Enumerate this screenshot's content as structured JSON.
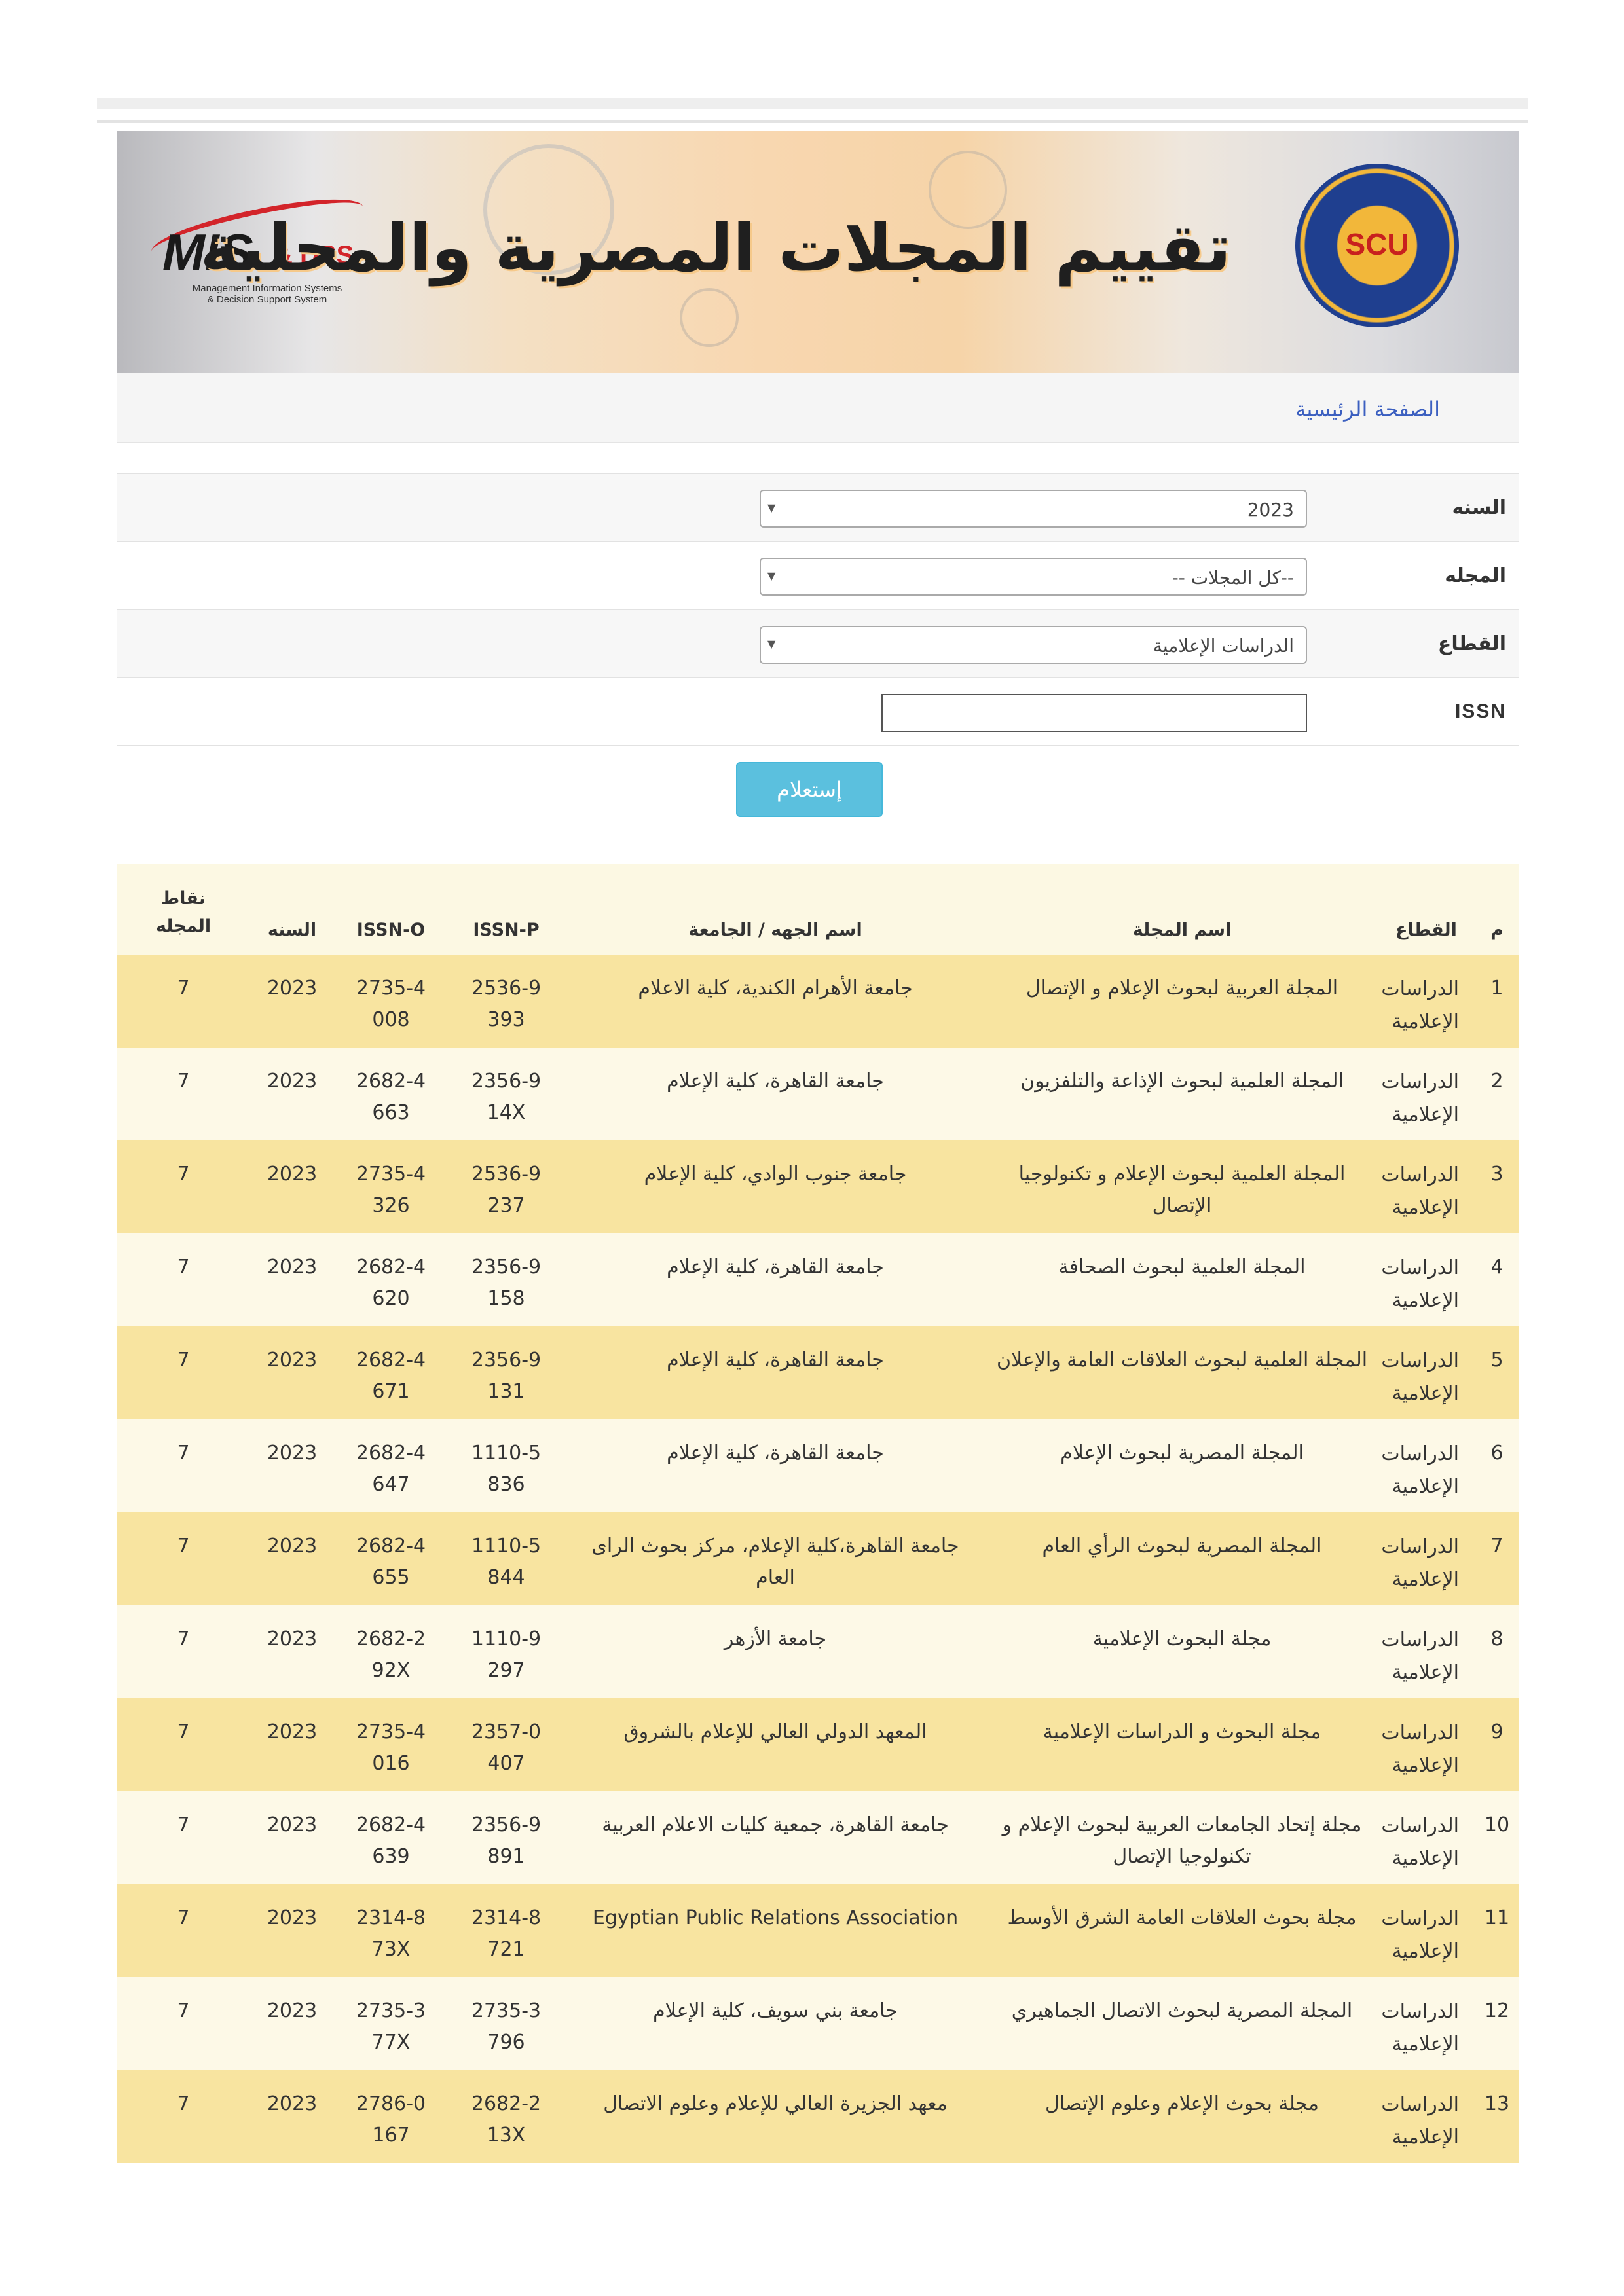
{
  "header": {
    "title": "تقييم المجلات المصرية والمحلية",
    "left_logo": {
      "main": "MIS",
      "accent": "& DSS",
      "sub1": "Management Information Systems",
      "sub2": "& Decision Support System"
    },
    "right_logo": {
      "text": "SCU"
    }
  },
  "breadcrumb": {
    "home": "الصفحة الرئيسية"
  },
  "form": {
    "year_label": "السنه",
    "year_value": "2023",
    "journal_label": "المجله",
    "journal_value": "--كل المجلات --",
    "sector_label": "القطاع",
    "sector_value": "الدراسات الإعلامية",
    "issn_label": "ISSN",
    "issn_value": "",
    "submit_label": "إستعلام"
  },
  "table": {
    "headers": {
      "num": "م",
      "sector": "القطاع",
      "journal": "اسم المجلة",
      "institution": "اسم الجهه / الجامعة",
      "issn_p": "ISSN-P",
      "issn_o": "ISSN-O",
      "year": "السنه",
      "points": "نقاط المجله"
    },
    "rows": [
      {
        "num": "1",
        "sector": "الدراسات الإعلامية",
        "journal": "المجلة العربية لبحوث الإعلام و الإتصال",
        "institution": "جامعة الأهرام الكندية، كلية الاعلام",
        "issn_p": "2536-9393",
        "issn_o": "2735-4008",
        "year": "2023",
        "points": "7"
      },
      {
        "num": "2",
        "sector": "الدراسات الإعلامية",
        "journal": "المجلة العلمية لبحوث الإذاعة والتلفزيون",
        "institution": "جامعة القاهرة، كلية الإعلام",
        "issn_p": "2356-914X",
        "issn_o": "2682-4663",
        "year": "2023",
        "points": "7"
      },
      {
        "num": "3",
        "sector": "الدراسات الإعلامية",
        "journal": "المجلة العلمية لبحوث الإعلام و تكنولوجيا الإتصال",
        "institution": "جامعة جنوب الوادي، كلية الإعلام",
        "issn_p": "2536-9237",
        "issn_o": "2735-4326",
        "year": "2023",
        "points": "7"
      },
      {
        "num": "4",
        "sector": "الدراسات الإعلامية",
        "journal": "المجلة العلمية لبحوث الصحافة",
        "institution": "جامعة القاهرة، كلية الإعلام",
        "issn_p": "2356-9158",
        "issn_o": "2682-4620",
        "year": "2023",
        "points": "7"
      },
      {
        "num": "5",
        "sector": "الدراسات الإعلامية",
        "journal": "المجلة العلمية لبحوث العلاقات العامة والإعلان",
        "institution": "جامعة القاهرة، كلية الإعلام",
        "issn_p": "2356-9131",
        "issn_o": "2682-4671",
        "year": "2023",
        "points": "7"
      },
      {
        "num": "6",
        "sector": "الدراسات الإعلامية",
        "journal": "المجلة المصرية لبحوث الإعلام",
        "institution": "جامعة القاهرة، كلية الإعلام",
        "issn_p": "1110-5836",
        "issn_o": "2682-4647",
        "year": "2023",
        "points": "7"
      },
      {
        "num": "7",
        "sector": "الدراسات الإعلامية",
        "journal": "المجلة المصرية لبحوث الرأي العام",
        "institution": "جامعة القاهرة،كلية الإعلام، مركز بحوث الراى العام",
        "issn_p": "1110-5844",
        "issn_o": "2682-4655",
        "year": "2023",
        "points": "7"
      },
      {
        "num": "8",
        "sector": "الدراسات الإعلامية",
        "journal": "مجلة البحوث الإعلامية",
        "institution": "جامعة الأزهر",
        "issn_p": "1110-9297",
        "issn_o": "2682-292X",
        "year": "2023",
        "points": "7"
      },
      {
        "num": "9",
        "sector": "الدراسات الإعلامية",
        "journal": "مجلة البحوث و الدراسات الإعلامية",
        "institution": "المعهد الدولي العالي للإعلام بالشروق",
        "issn_p": "2357-0407",
        "issn_o": "2735-4016",
        "year": "2023",
        "points": "7"
      },
      {
        "num": "10",
        "sector": "الدراسات الإعلامية",
        "journal": "مجلة إتحاد الجامعات العربية لبحوث الإعلام و تكنولوجيا الإتصال",
        "institution": "جامعة القاهرة، جمعية كليات الاعلام العربية",
        "issn_p": "2356-9891",
        "issn_o": "2682-4639",
        "year": "2023",
        "points": "7"
      },
      {
        "num": "11",
        "sector": "الدراسات الإعلامية",
        "journal": "مجلة بحوث العلاقات العامة الشرق الأوسط",
        "institution": "Egyptian Public Relations Association",
        "issn_p": "2314-8721",
        "issn_o": "2314-873X",
        "year": "2023",
        "points": "7"
      },
      {
        "num": "12",
        "sector": "الدراسات الإعلامية",
        "journal": "المجلة المصرية لبحوث الاتصال الجماهيري",
        "institution": "جامعة بني سويف، كلية الإعلام",
        "issn_p": "2735-3796",
        "issn_o": "2735-377X",
        "year": "2023",
        "points": "7"
      },
      {
        "num": "13",
        "sector": "الدراسات الإعلامية",
        "journal": "مجلة بحوث الإعلام وعلوم الإتصال",
        "institution": "معهد الجزيرة العالي للإعلام وعلوم الاتصال",
        "issn_p": "2682-213X",
        "issn_o": "2786-0167",
        "year": "2023",
        "points": "7"
      }
    ]
  }
}
